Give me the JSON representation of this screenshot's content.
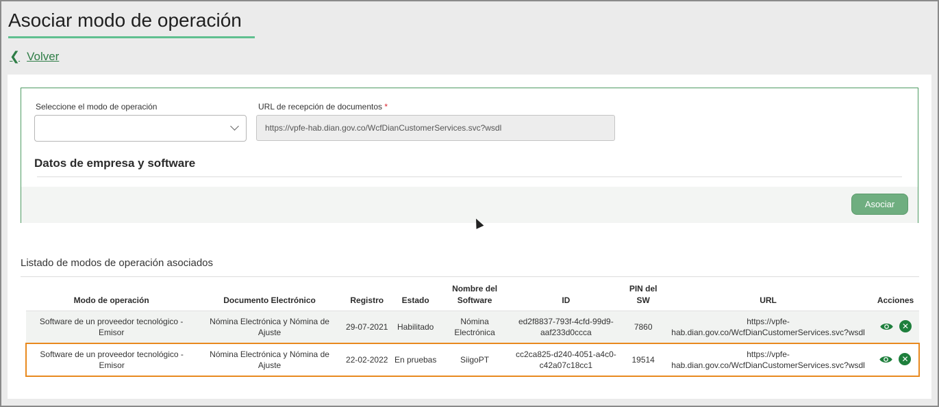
{
  "header": {
    "title": "Asociar modo de operación",
    "back_label": "Volver"
  },
  "form": {
    "mode_label": "Seleccione el modo de operación",
    "mode_value": "",
    "url_label": "URL de recepción de documentos",
    "url_required_mark": "*",
    "url_value": "https://vpfe-hab.dian.gov.co/WcfDianCustomerServices.svc?wsdl",
    "section_title": "Datos de empresa y software",
    "submit_label": "Asociar"
  },
  "list": {
    "title": "Listado de modos de operación asociados",
    "columns": {
      "modo": "Modo de operación",
      "documento": "Documento Electrónico",
      "registro": "Registro",
      "estado": "Estado",
      "nombre": "Nombre del Software",
      "id": "ID",
      "pin": "PIN del SW",
      "url": "URL",
      "acciones": "Acciones"
    },
    "rows": [
      {
        "modo": "Software de un proveedor tecnológico - Emisor",
        "documento": "Nómina Electrónica y Nómina de Ajuste",
        "registro": "29-07-2021",
        "estado": "Habilitado",
        "nombre": "Nómina Electrónica",
        "id": "ed2f8837-793f-4cfd-99d9-aaf233d0ccca",
        "pin": "7860",
        "url": "https://vpfe-hab.dian.gov.co/WcfDianCustomerServices.svc?wsdl"
      },
      {
        "modo": "Software de un proveedor tecnológico - Emisor",
        "documento": "Nómina Electrónica y Nómina de Ajuste",
        "registro": "22-02-2022",
        "estado": "En pruebas",
        "nombre": "SiigoPT",
        "id": "cc2ca825-d240-4051-a4c0-c42a07c18cc1",
        "pin": "19514",
        "url": "https://vpfe-hab.dian.gov.co/WcfDianCustomerServices.svc?wsdl"
      }
    ]
  },
  "icons": {
    "back": "chevron-left-icon",
    "view": "eye-icon",
    "delete": "close-circle-icon",
    "select": "chevron-down-icon"
  },
  "colors": {
    "accent_green": "#2e7d46",
    "button_green": "#6fae80",
    "selected_row_border": "#e8891e"
  }
}
